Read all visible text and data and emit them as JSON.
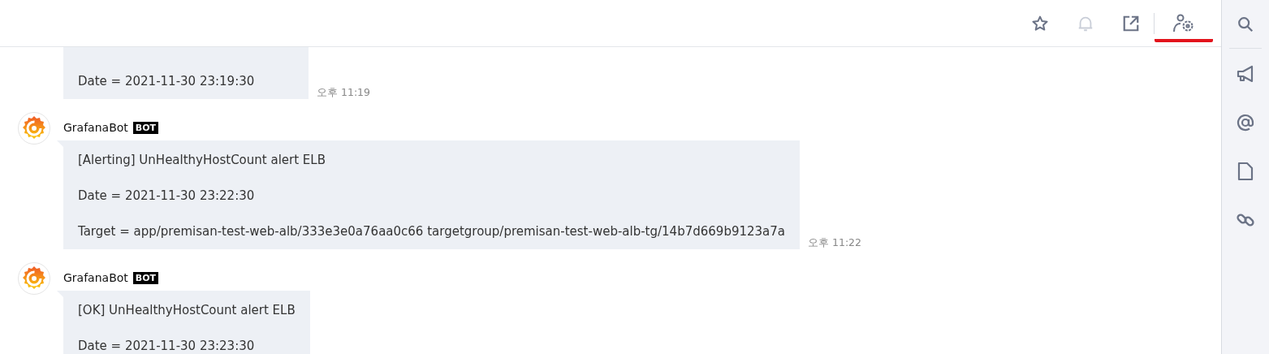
{
  "toolbar": [
    {
      "kind": "star",
      "selected": false,
      "disabled": false
    },
    {
      "kind": "bell",
      "selected": false,
      "disabled": true
    },
    {
      "kind": "external",
      "selected": false,
      "disabled": false
    },
    {
      "kind": "user-settings",
      "selected": true,
      "disabled": false
    }
  ],
  "sidebar": [
    {
      "kind": "search"
    },
    {
      "kind": "megaphone"
    },
    {
      "kind": "mention"
    },
    {
      "kind": "file"
    },
    {
      "kind": "link"
    }
  ],
  "messages": [
    {
      "lines": [
        "Date = 2021-11-30 23:19:30"
      ],
      "time": "오후 11:19"
    },
    {
      "sender": "GrafanaBot",
      "badge": "BOT",
      "lines": [
        "[Alerting] UnHealthyHostCount alert ELB",
        "Date = 2021-11-30 23:22:30",
        "Target = app/premisan-test-web-alb/333e3e0a76aa0c66 targetgroup/premisan-test-web-alb-tg/14b7d669b9123a7a"
      ],
      "time": "오후 11:22"
    },
    {
      "sender": "GrafanaBot",
      "badge": "BOT",
      "lines": [
        "[OK] UnHealthyHostCount alert ELB",
        "Date = 2021-11-30 23:23:30"
      ]
    }
  ]
}
